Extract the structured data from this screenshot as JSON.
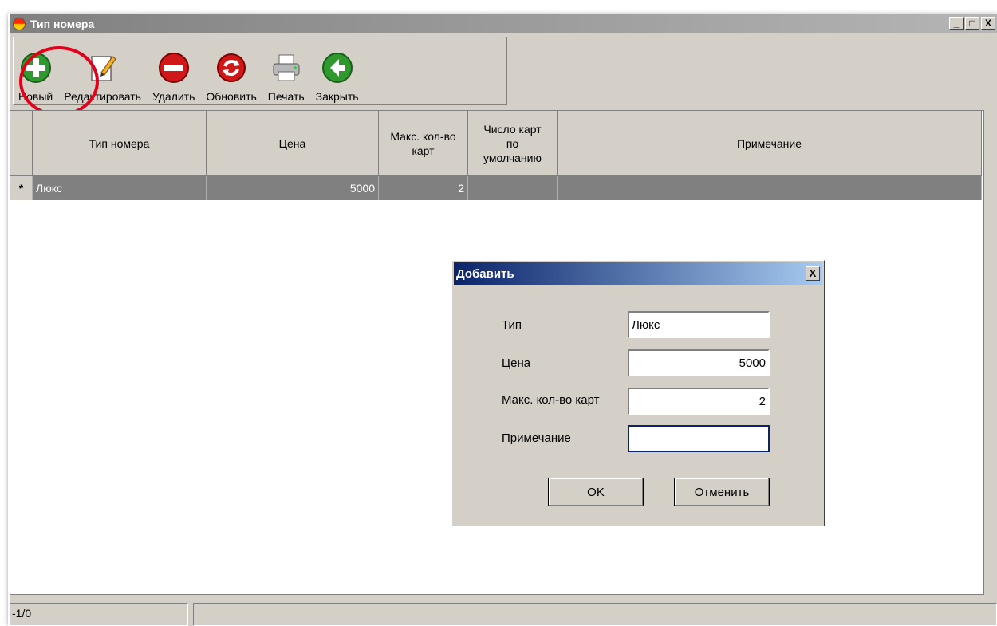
{
  "window": {
    "title": "Тип номера"
  },
  "window_buttons": {
    "minimize": "_",
    "maximize": "□",
    "close": "X"
  },
  "toolbar": {
    "new": "Новый",
    "edit": "Редактировать",
    "delete": "Удалить",
    "refresh": "Обновить",
    "print": "Печать",
    "close": "Закрыть"
  },
  "grid": {
    "columns": [
      "Тип номера",
      "Цена",
      "Макс. кол-во карт",
      "Число карт по умолчанию",
      "Примечание"
    ],
    "rows": [
      {
        "marker": "*",
        "type": "Люкс",
        "price": "5000",
        "max_cards": "2",
        "default_cards": "",
        "note": ""
      }
    ]
  },
  "statusbar": {
    "position": "-1/0"
  },
  "dialog": {
    "title": "Добавить",
    "close": "X",
    "fields": {
      "type_label": "Тип",
      "type_value": "Люкс",
      "price_label": "Цена",
      "price_value": "5000",
      "max_cards_label": "Макс. кол-во карт",
      "max_cards_value": "2",
      "note_label": "Примечание",
      "note_value": ""
    },
    "ok": "OK",
    "cancel": "Отменить"
  },
  "colors": {
    "accent_highlight": "#e2001a",
    "dialog_title": "#0a246a",
    "selected_row": "#808080"
  }
}
